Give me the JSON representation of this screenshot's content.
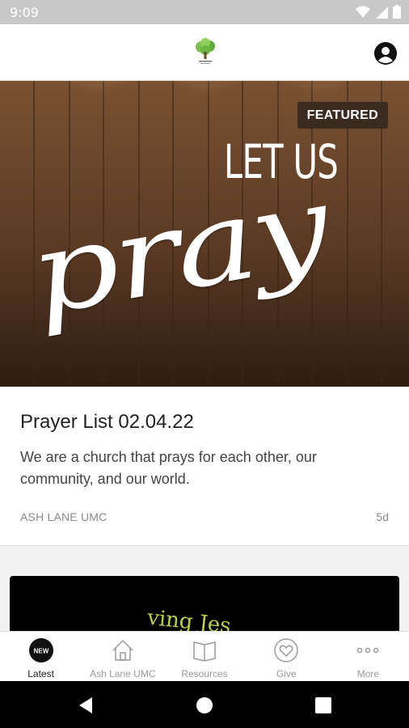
{
  "status_bar": {
    "time": "9:09"
  },
  "featured": {
    "badge": "FEATURED",
    "headline_top": "LET US",
    "headline_script": "pray"
  },
  "card": {
    "title": "Prayer List 02.04.22",
    "description": "We are a church that prays for each other, our community, and our world.",
    "source": "ASH LANE UMC",
    "age": "5d"
  },
  "next_card": {
    "partial_text": "ving Jes"
  },
  "bottom_nav": [
    {
      "label": "Latest",
      "icon": "new-badge-icon",
      "active": true,
      "badge_text": "NEW"
    },
    {
      "label": "Ash Lane UMC",
      "icon": "home-icon",
      "active": false
    },
    {
      "label": "Resources",
      "icon": "book-icon",
      "active": false
    },
    {
      "label": "Give",
      "icon": "heart-icon",
      "active": false
    },
    {
      "label": "More",
      "icon": "more-dots-icon",
      "active": false
    }
  ],
  "colors": {
    "hero_wood": "#5a3a24",
    "badge_bg": "#3a2a20",
    "accent_green": "#b9d14a"
  }
}
